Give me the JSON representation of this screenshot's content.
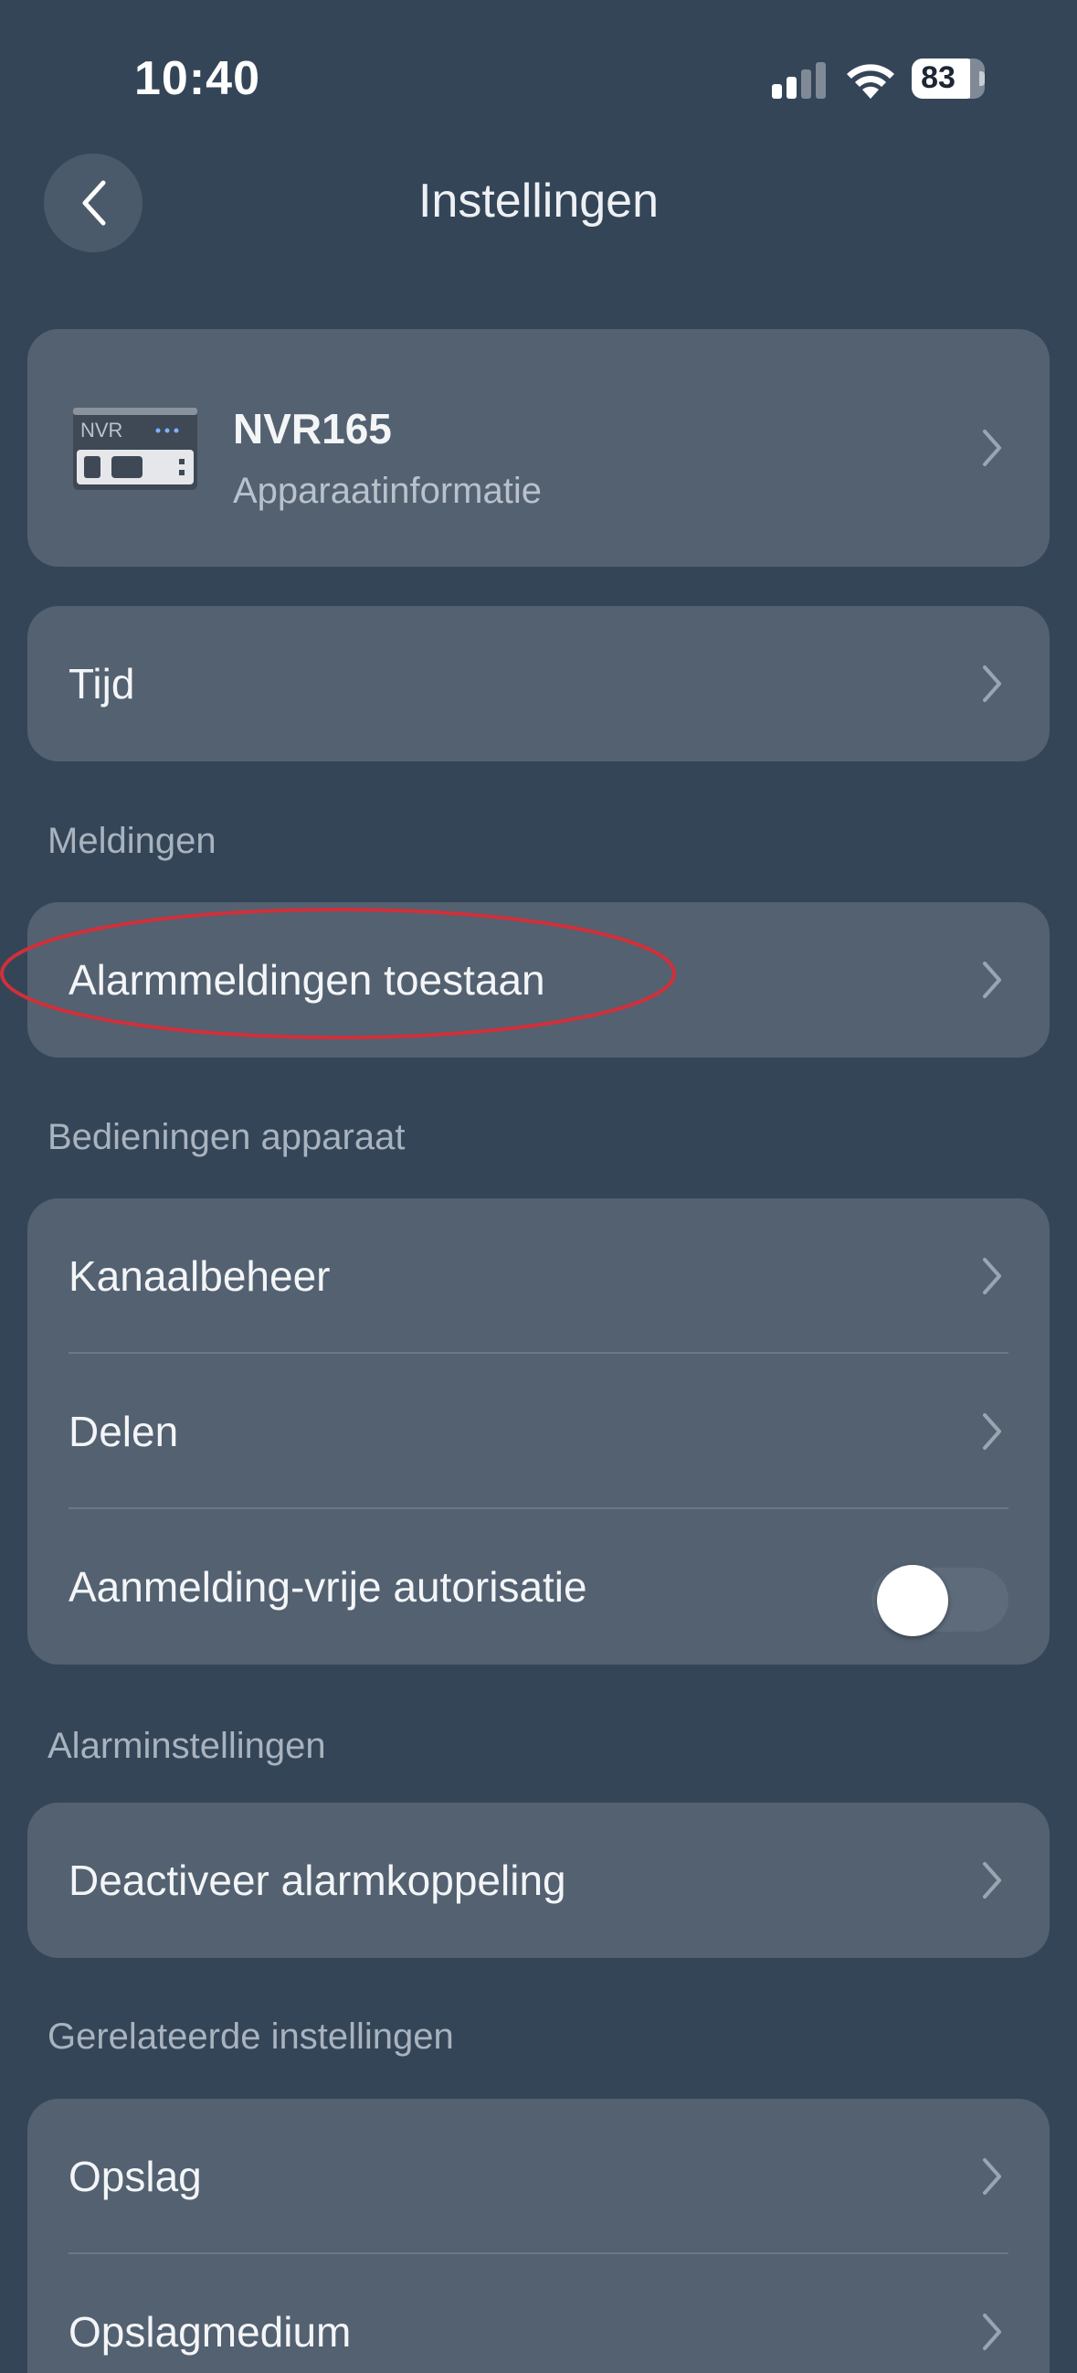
{
  "status_bar": {
    "time": "10:40",
    "battery": "83"
  },
  "header": {
    "title": "Instellingen"
  },
  "device": {
    "name": "NVR165",
    "subtitle": "Apparaatinformatie",
    "icon_text": "NVR"
  },
  "time_row": {
    "label": "Tijd"
  },
  "sections": {
    "notifications": {
      "title": "Meldingen",
      "items": [
        {
          "label": "Alarmmeldingen toestaan"
        }
      ]
    },
    "device_controls": {
      "title": "Bedieningen apparaat",
      "items": [
        {
          "label": "Kanaalbeheer"
        },
        {
          "label": "Delen"
        },
        {
          "label": "Aanmelding-vrije autorisatie",
          "toggle": false
        }
      ]
    },
    "alarm_settings": {
      "title": "Alarminstellingen",
      "items": [
        {
          "label": "Deactiveer alarmkoppeling"
        }
      ]
    },
    "related_settings": {
      "title": "Gerelateerde instellingen",
      "items": [
        {
          "label": "Opslag"
        },
        {
          "label": "Opslagmedium"
        }
      ]
    }
  },
  "colors": {
    "background": "#344558",
    "card": "#536171",
    "highlight": "#d0303a"
  }
}
